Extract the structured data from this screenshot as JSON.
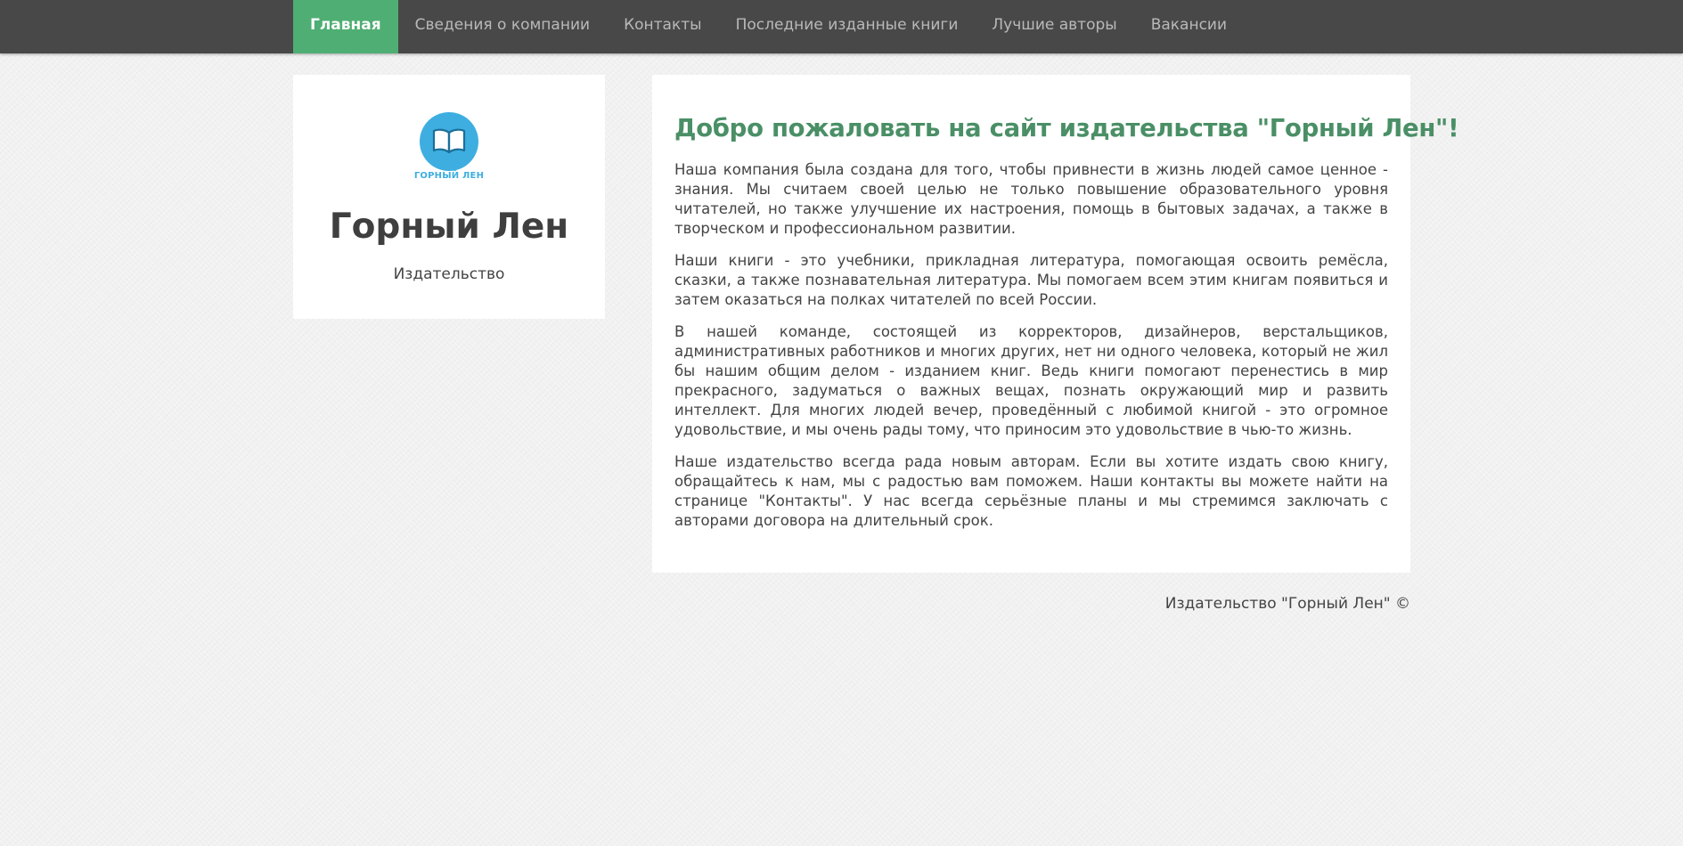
{
  "nav": {
    "items": [
      {
        "label": "Главная",
        "active": true
      },
      {
        "label": "Сведения о компании",
        "active": false
      },
      {
        "label": "Контакты",
        "active": false
      },
      {
        "label": "Последние изданные книги",
        "active": false
      },
      {
        "label": "Лучшие авторы",
        "active": false
      },
      {
        "label": "Вакансии",
        "active": false
      }
    ]
  },
  "sidebar": {
    "logo_text": "ГОРНЫЙ ЛЕН",
    "logo_icon": "open-book-icon",
    "title": "Горный Лен",
    "subtitle": "Издательство"
  },
  "main": {
    "title": "Добро пожаловать на сайт издательства \"Горный Лен\"!",
    "paragraphs": [
      "Наша компания была создана для того, чтобы привнести в жизнь людей самое ценное - знания. Мы считаем своей целью не только повышение образовательного уровня читателей, но также улучшение их настроения, помощь в бытовых задачах, а также в творческом и профессиональном развитии.",
      "Наши книги - это учебники, прикладная литература, помогающая освоить ремёсла, сказки, а также познавательная литература. Мы помогаем всем этим книгам появиться и затем оказаться на полках читателей по всей России.",
      "В нашей команде, состоящей из корректоров, дизайнеров, верстальщиков, административных работников и многих других, нет ни одного человека, который не жил бы нашим общим делом - изданием книг. Ведь книги помогают перенестись в мир прекрасного, задуматься о важных вещах, познать окружающий мир и развить интеллект. Для многих людей вечер, проведённый с любимой книгой - это огромное удовольствие, и мы очень рады тому, что приносим это удовольствие в чью-то жизнь.",
      "Наше издательство всегда рада новым авторам. Если вы хотите издать свою книгу, обращайтесь к нам, мы с радостью вам поможем. Наши контакты вы можете найти на странице \"Контакты\". У нас всегда серьёзные планы и мы стремимся заключать с авторами договора на длительный срок."
    ]
  },
  "footer": {
    "text": "Издательство \"Горный Лен\" ©"
  },
  "colors": {
    "navbar": "#484848",
    "active_nav": "#4fae73",
    "heading": "#4a8f66",
    "logo": "#3eaee0"
  }
}
